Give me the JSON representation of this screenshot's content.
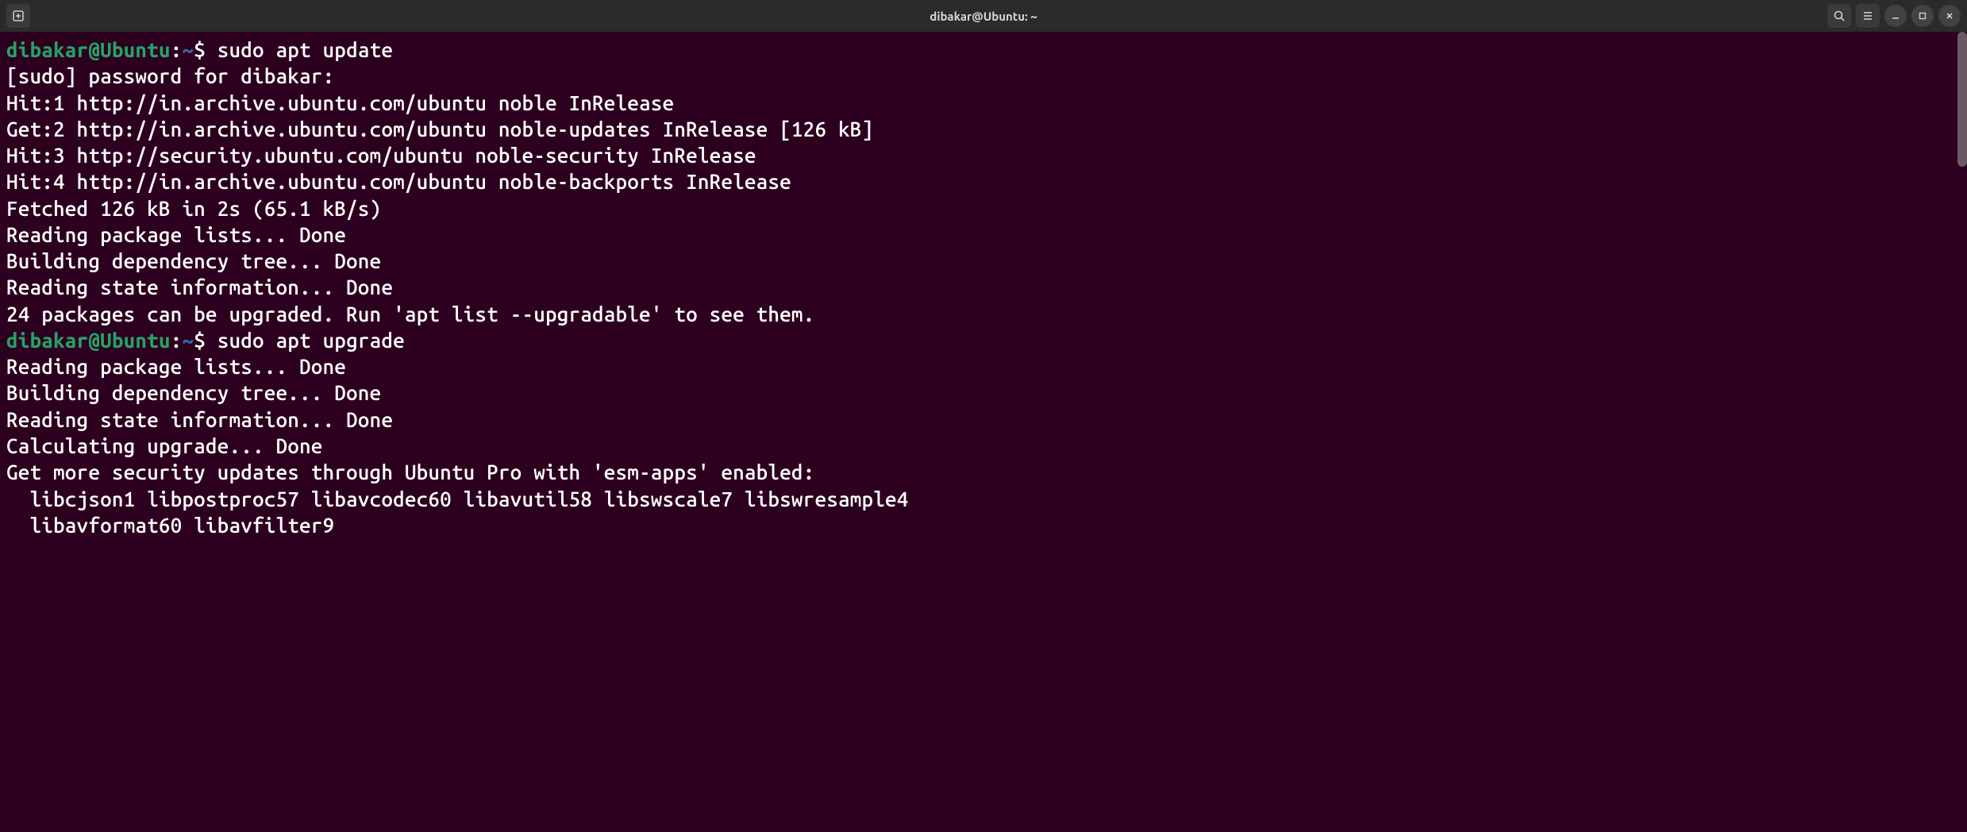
{
  "window": {
    "title": "dibakar@Ubuntu: ~"
  },
  "prompt": {
    "user_host": "dibakar@Ubuntu",
    "colon": ":",
    "path": "~",
    "dollar": "$ "
  },
  "session": [
    {
      "type": "cmd",
      "text": "sudo apt update"
    },
    {
      "type": "out",
      "text": "[sudo] password for dibakar: "
    },
    {
      "type": "out",
      "text": "Hit:1 http://in.archive.ubuntu.com/ubuntu noble InRelease"
    },
    {
      "type": "out",
      "text": "Get:2 http://in.archive.ubuntu.com/ubuntu noble-updates InRelease [126 kB]"
    },
    {
      "type": "out",
      "text": "Hit:3 http://security.ubuntu.com/ubuntu noble-security InRelease"
    },
    {
      "type": "out",
      "text": "Hit:4 http://in.archive.ubuntu.com/ubuntu noble-backports InRelease"
    },
    {
      "type": "out",
      "text": "Fetched 126 kB in 2s (65.1 kB/s)"
    },
    {
      "type": "out",
      "text": "Reading package lists... Done"
    },
    {
      "type": "out",
      "text": "Building dependency tree... Done"
    },
    {
      "type": "out",
      "text": "Reading state information... Done"
    },
    {
      "type": "out",
      "text": "24 packages can be upgraded. Run 'apt list --upgradable' to see them."
    },
    {
      "type": "cmd",
      "text": "sudo apt upgrade"
    },
    {
      "type": "out",
      "text": "Reading package lists... Done"
    },
    {
      "type": "out",
      "text": "Building dependency tree... Done"
    },
    {
      "type": "out",
      "text": "Reading state information... Done"
    },
    {
      "type": "out",
      "text": "Calculating upgrade... Done"
    },
    {
      "type": "out",
      "text": "Get more security updates through Ubuntu Pro with 'esm-apps' enabled:"
    },
    {
      "type": "out",
      "text": "  libcjson1 libpostproc57 libavcodec60 libavutil58 libswscale7 libswresample4"
    },
    {
      "type": "out",
      "text": "  libavformat60 libavfilter9"
    }
  ]
}
